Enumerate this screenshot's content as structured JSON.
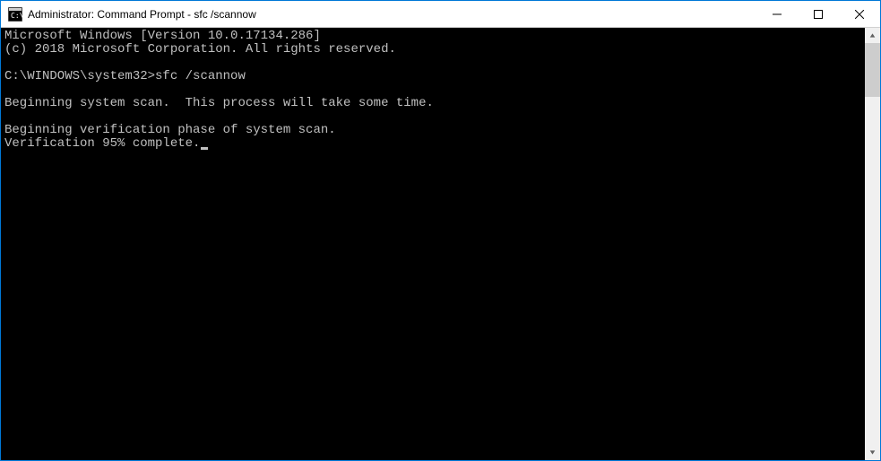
{
  "window": {
    "title": "Administrator: Command Prompt - sfc  /scannow"
  },
  "console": {
    "line1": "Microsoft Windows [Version 10.0.17134.286]",
    "line2": "(c) 2018 Microsoft Corporation. All rights reserved.",
    "blank1": "",
    "promptPath": "C:\\WINDOWS\\system32>",
    "promptCmd": "sfc /scannow",
    "blank2": "",
    "line4": "Beginning system scan.  This process will take some time.",
    "blank3": "",
    "line5": "Beginning verification phase of system scan.",
    "line6": "Verification 95% complete."
  }
}
